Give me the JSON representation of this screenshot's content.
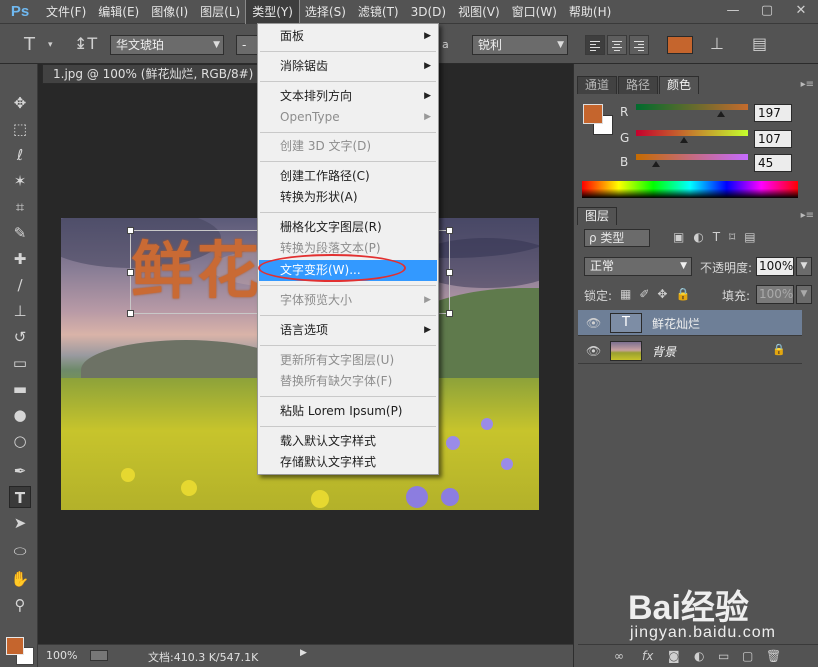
{
  "app": {
    "logo": "Ps"
  },
  "menubar": {
    "items": [
      "文件(F)",
      "编辑(E)",
      "图像(I)",
      "图层(L)",
      "类型(Y)",
      "选择(S)",
      "滤镜(T)",
      "3D(D)",
      "视图(V)",
      "窗口(W)",
      "帮助(H)"
    ],
    "active_index": 4,
    "window_controls": [
      "—",
      "▢",
      "✕"
    ]
  },
  "options": {
    "font_family": "华文琥珀",
    "font_style": "-",
    "aa_label": "a",
    "antialias": "锐利",
    "text_color": "#c5652d"
  },
  "document": {
    "tab_title": "1.jpg @ 100% (鲜花灿烂, RGB/8#) *",
    "tab_close": "×",
    "text_layer_content": "鲜花灿烂"
  },
  "type_menu": {
    "items": [
      {
        "label": "面板",
        "submenu": true,
        "disabled": false
      },
      {
        "label": "消除锯齿",
        "submenu": true,
        "disabled": false
      },
      {
        "label": "文本排列方向",
        "submenu": true,
        "disabled": false
      },
      {
        "label": "OpenType",
        "submenu": true,
        "disabled": true
      },
      {
        "label": "创建 3D 文字(D)",
        "submenu": false,
        "disabled": true
      },
      {
        "label": "创建工作路径(C)",
        "submenu": false,
        "disabled": false
      },
      {
        "label": "转换为形状(A)",
        "submenu": false,
        "disabled": false
      },
      {
        "label": "栅格化文字图层(R)",
        "submenu": false,
        "disabled": false
      },
      {
        "label": "转换为段落文本(P)",
        "submenu": false,
        "disabled": true
      },
      {
        "label": "文字变形(W)...",
        "submenu": false,
        "disabled": false,
        "highlighted": true
      },
      {
        "label": "字体预览大小",
        "submenu": true,
        "disabled": true
      },
      {
        "label": "语言选项",
        "submenu": true,
        "disabled": false
      },
      {
        "label": "更新所有文字图层(U)",
        "submenu": false,
        "disabled": true
      },
      {
        "label": "替换所有缺欠字体(F)",
        "submenu": false,
        "disabled": true
      },
      {
        "label": "粘贴 Lorem Ipsum(P)",
        "submenu": false,
        "disabled": false
      },
      {
        "label": "载入默认文字样式",
        "submenu": false,
        "disabled": false
      },
      {
        "label": "存储默认文字样式",
        "submenu": false,
        "disabled": false
      }
    ]
  },
  "color_panel": {
    "tabs": [
      "通道",
      "路径",
      "颜色"
    ],
    "active_tab": 2,
    "channels": [
      {
        "name": "R",
        "value": "197"
      },
      {
        "name": "G",
        "value": "107"
      },
      {
        "name": "B",
        "value": "45"
      }
    ],
    "foreground": "#c5652d",
    "background": "#ffffff"
  },
  "layers_panel": {
    "tab": "图层",
    "filter_label": "ρ 类型",
    "blend_mode": "正常",
    "opacity_label": "不透明度:",
    "opacity_value": "100%",
    "lock_label": "锁定:",
    "fill_label": "填充:",
    "fill_value": "100%",
    "layers": [
      {
        "name": "鲜花灿烂",
        "type": "text",
        "thumb": "T",
        "selected": true
      },
      {
        "name": "背景",
        "type": "image",
        "locked": true,
        "selected": false
      }
    ]
  },
  "status": {
    "zoom": "100%",
    "doc_size": "文档:410.3 K/547.1K"
  },
  "watermark": {
    "text": "Bai经验",
    "url": "jingyan.baidu.com"
  }
}
